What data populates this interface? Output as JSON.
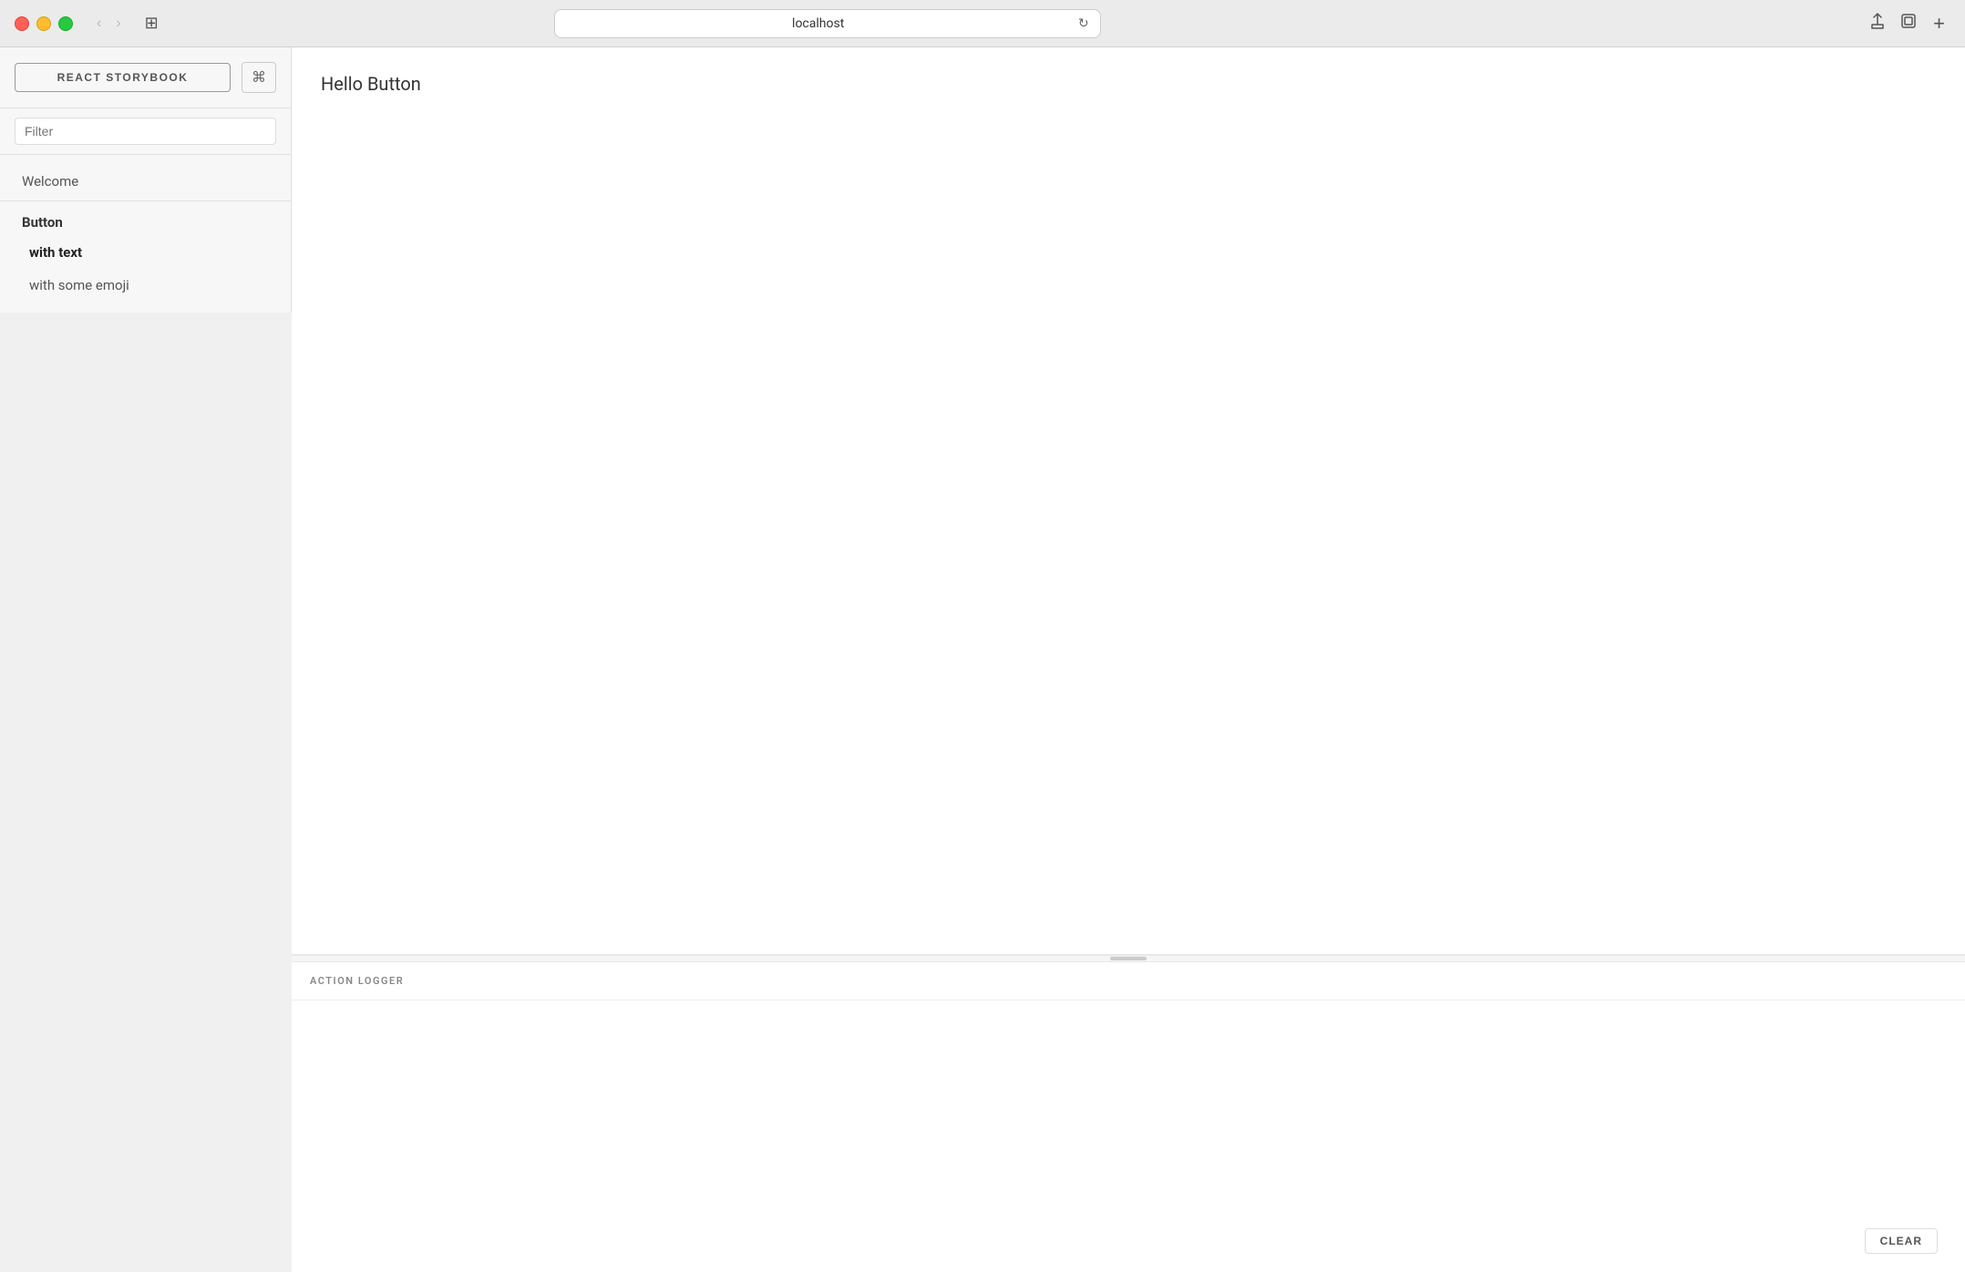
{
  "browser": {
    "address": "localhost",
    "back_label": "‹",
    "forward_label": "›",
    "sidebar_toggle_label": "⊞",
    "reload_label": "↻",
    "share_label": "↑",
    "tabs_label": "⊡",
    "plus_label": "+"
  },
  "sidebar": {
    "storybook_label": "REACT STORYBOOK",
    "keyboard_icon": "⌘",
    "filter_placeholder": "Filter",
    "nav": {
      "welcome_label": "Welcome",
      "button_label": "Button",
      "with_text_label": "with text",
      "with_some_emoji_label": "with some emoji"
    }
  },
  "main": {
    "story_title": "Hello Button"
  },
  "action_logger": {
    "title": "ACTION LOGGER",
    "clear_label": "CLEAR"
  },
  "colors": {
    "traffic_close": "#ff5f57",
    "traffic_minimize": "#febc2e",
    "traffic_maximize": "#28c840",
    "active_nav": "#222222",
    "sidebar_bg": "#f7f7f7"
  }
}
